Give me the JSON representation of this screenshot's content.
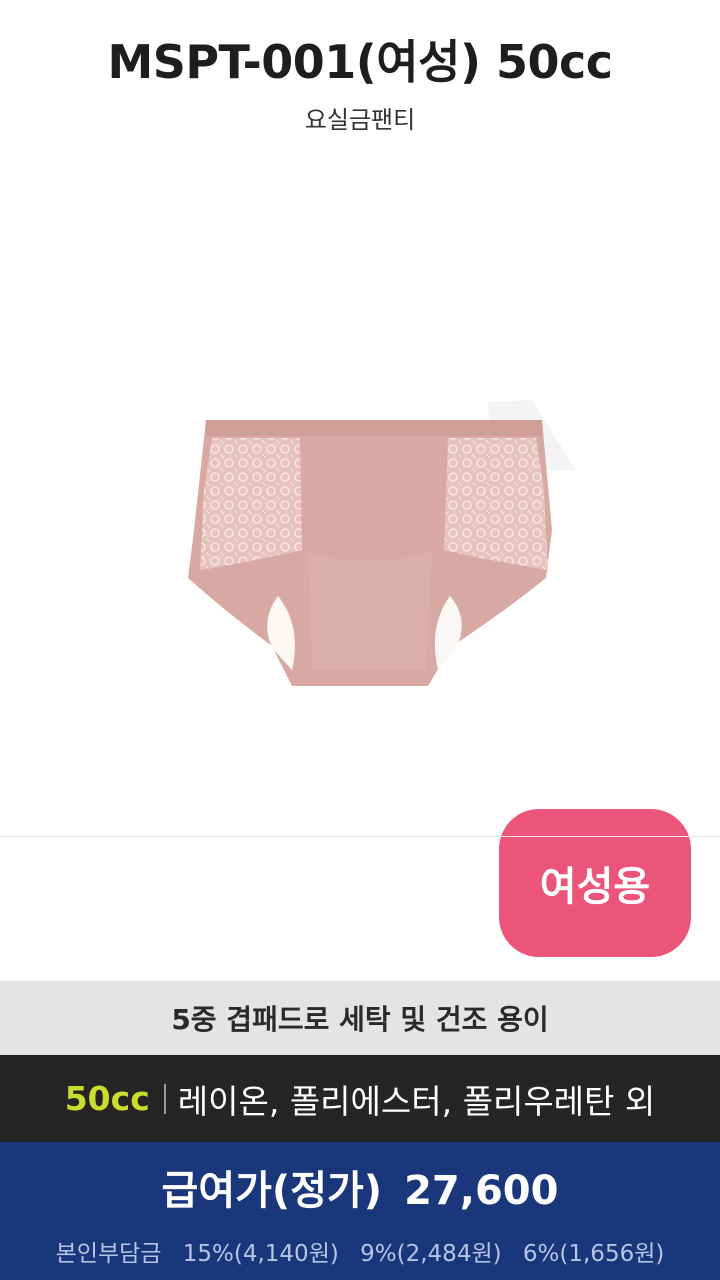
{
  "header": {
    "title": "MSPT-001(여성) 50cc",
    "subtitle": "요실금팬티"
  },
  "product": {
    "image_icon": "brief-underwear-icon",
    "image_color": "#d7a9a2",
    "badge_label": "여성용",
    "badge_color": "#ea5579"
  },
  "feature": {
    "text": "5중 겹패드로 세탁 및 건조 용이"
  },
  "material": {
    "capacity": "50cc",
    "fabric": "레이온, 폴리에스터, 폴리우레탄 외",
    "capacity_color": "#c8dd2c"
  },
  "price": {
    "label": "급여가(정가)",
    "amount": "27,600",
    "copay_label": "본인부담금",
    "copay_options": [
      "15%(4,140원)",
      "9%(2,484원)",
      "6%(1,656원)"
    ],
    "bar_color": "#1b377c"
  }
}
